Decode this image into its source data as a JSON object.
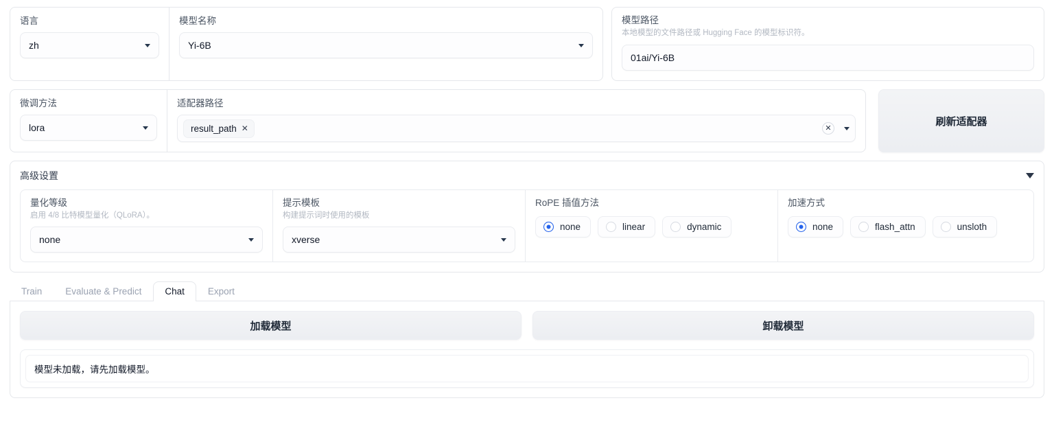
{
  "row1": {
    "language": {
      "label": "语言",
      "value": "zh"
    },
    "model_name": {
      "label": "模型名称",
      "value": "Yi-6B"
    },
    "model_path": {
      "label": "模型路径",
      "description": "本地模型的文件路径或 Hugging Face 的模型标识符。",
      "value": "01ai/Yi-6B"
    }
  },
  "row2": {
    "finetune_method": {
      "label": "微调方法",
      "value": "lora"
    },
    "adapter_path": {
      "label": "适配器路径",
      "tokens": [
        "result_path"
      ],
      "clear_icon": "close-icon"
    },
    "refresh_button": {
      "label": "刷新适配器"
    }
  },
  "advanced": {
    "title": "高级设置",
    "expand_icon": "chevron-down-icon",
    "quantization": {
      "label": "量化等级",
      "description": "启用 4/8 比特模型量化（QLoRA）。",
      "value": "none"
    },
    "template": {
      "label": "提示模板",
      "description": "构建提示词时使用的模板",
      "value": "xverse"
    },
    "rope": {
      "label": "RoPE 插值方法",
      "options": [
        "none",
        "linear",
        "dynamic"
      ],
      "selected": "none"
    },
    "booster": {
      "label": "加速方式",
      "options": [
        "none",
        "flash_attn",
        "unsloth"
      ],
      "selected": "none"
    }
  },
  "tabs": {
    "items": [
      "Train",
      "Evaluate & Predict",
      "Chat",
      "Export"
    ],
    "active": "Chat"
  },
  "chat": {
    "load_button": "加载模型",
    "unload_button": "卸载模型",
    "status": "模型未加载，请先加载模型。"
  },
  "colors": {
    "accent": "#2563eb",
    "border": "#e5e7eb",
    "muted_text": "#b2b8c2",
    "button_grey": "#eceef2"
  }
}
